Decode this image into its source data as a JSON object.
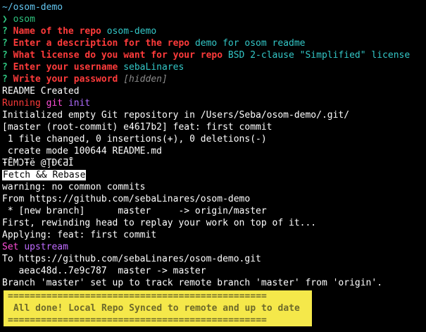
{
  "terminal": {
    "cwd": "~/osom-demo",
    "prompt_symbol": "❯",
    "command": "osom",
    "question_mark": "?",
    "questions": [
      {
        "label": "Name of the repo",
        "answer": "osom-demo"
      },
      {
        "label": "Enter a description for the repo",
        "answer": "demo for osom readme"
      },
      {
        "label": "What license do you want for your repo",
        "answer": "BSD 2-clause \"Simplified\" license"
      },
      {
        "label": "Enter your username",
        "answer": "sebaLinares"
      },
      {
        "label": "Write your password",
        "answer": "[hidden]"
      }
    ],
    "readme_created": "README Created",
    "running_word": "Running",
    "git_word": "git",
    "init_word": "init",
    "git_init_output": "Initialized empty Git repository in /Users/Seba/osom-demo/.git/",
    "commit_line": "[master (root-commit) e4617b2] feat: first commit",
    "files_changed": " 1 file changed, 0 insertions(+), 0 deletions(-)",
    "create_mode": " create mode 100644 README.md",
    "garbled": "ŦĒMƆŦĕ @ŢĐ€ƋĪ",
    "fetch_rebase": "Fetch && Rebase",
    "warning": "warning: no common commits",
    "from_line": "From https://github.com/sebaLinares/osom-demo",
    "new_branch": " * [new branch]      master     -> origin/master",
    "rewinding": "First, rewinding head to replay your work on top of it...",
    "applying": "Applying: feat: first commit",
    "set_word": "Set",
    "upstream_word": "upstream",
    "to_line": "To https://github.com/sebaLinares/osom-demo.git",
    "push_line": "   aeac48d..7e9c787  master -> master",
    "branch_setup": "Branch 'master' set up to track remote branch 'master' from 'origin'.",
    "separator": "===============================================",
    "done_message": " All done! Local Repo Synced to remote and up to date"
  },
  "colors": {
    "background": "#000000",
    "cwd": "#63c6f0",
    "prompt": "#2ec27e",
    "question": "#ff3b3b",
    "answer": "#33c7c7",
    "highlight_box": "#f5e84a"
  }
}
